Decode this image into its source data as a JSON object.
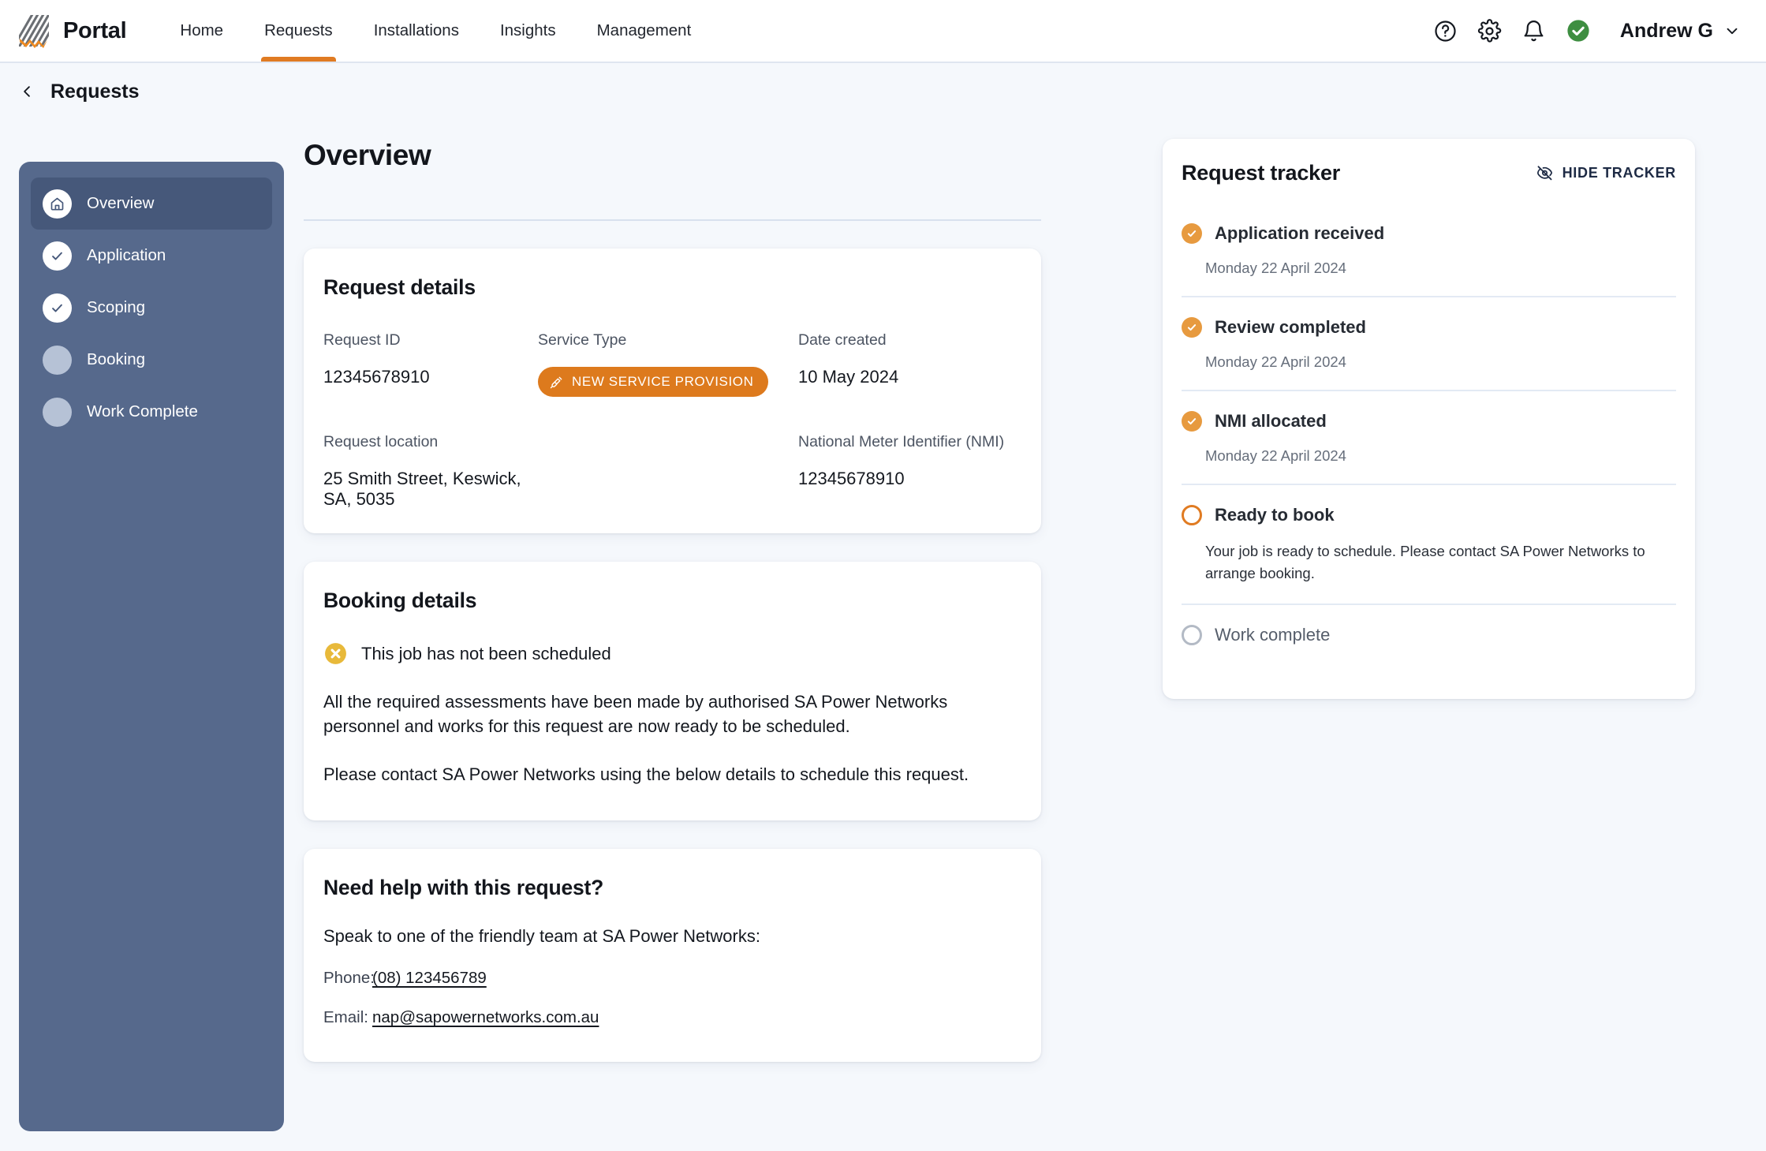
{
  "header": {
    "brand": "Portal",
    "logo_icon": "hatched-square-lightning-logo",
    "nav": [
      {
        "label": "Home",
        "active": false
      },
      {
        "label": "Requests",
        "active": true
      },
      {
        "label": "Installations",
        "active": false
      },
      {
        "label": "Insights",
        "active": false
      },
      {
        "label": "Management",
        "active": false
      }
    ],
    "icons": [
      "help-circle-icon",
      "gear-icon",
      "bell-icon",
      "check-circle-icon"
    ],
    "user": "Andrew G",
    "user_chevron": "chevron-down-icon",
    "accent_color": "#e07b22"
  },
  "breadcrumb": {
    "back_icon": "chevron-left-icon",
    "title": "Requests"
  },
  "sidebar": {
    "background_color": "#56698c",
    "items": [
      {
        "label": "Overview",
        "icon": "home-icon",
        "state": "active"
      },
      {
        "label": "Application",
        "icon": "check-icon",
        "state": "complete"
      },
      {
        "label": "Scoping",
        "icon": "check-icon",
        "state": "complete"
      },
      {
        "label": "Booking",
        "icon": "",
        "state": "pending"
      },
      {
        "label": "Work Complete",
        "icon": "",
        "state": "pending"
      }
    ]
  },
  "main": {
    "page_title": "Overview",
    "request_details": {
      "heading": "Request details",
      "request_id_label": "Request ID",
      "request_id_value": "12345678910",
      "service_type_label": "Service Type",
      "service_type_badge": "NEW SERVICE PROVISION",
      "service_type_badge_icon": "plug-connector-icon",
      "date_created_label": "Date created",
      "date_created_value": "10 May 2024",
      "request_location_label": "Request location",
      "request_location_value": "25 Smith Street, Keswick, SA, 5035",
      "nmi_label": "National Meter Identifier (NMI)",
      "nmi_value": "12345678910"
    },
    "booking_details": {
      "heading": "Booking details",
      "status_icon": "x-circle-icon",
      "status_color": "#e8b93a",
      "status_text": "This job has not been scheduled",
      "paragraph_1": "All the required assessments have been made by authorised SA Power Networks personnel and works for this request are now ready to be scheduled.",
      "paragraph_2": "Please contact SA Power Networks using the below details to schedule this request."
    },
    "help": {
      "heading": "Need help with this request?",
      "intro": "Speak to one of the friendly team at SA Power Networks:",
      "phone_label": "Phone:",
      "phone_value": "(08) 123456789",
      "email_label": "Email:",
      "email_value": "nap@sapowernetworks.com.au"
    }
  },
  "tracker": {
    "title": "Request tracker",
    "hide_label": "HIDE TRACKER",
    "hide_icon": "eye-off-icon",
    "steps": [
      {
        "label": "Application received",
        "date": "Monday 22 April 2024",
        "note": "",
        "state": "done"
      },
      {
        "label": "Review completed",
        "date": "Monday 22 April 2024",
        "note": "",
        "state": "done"
      },
      {
        "label": "NMI allocated",
        "date": "Monday 22 April 2024",
        "note": "",
        "state": "done"
      },
      {
        "label": "Ready to book",
        "date": "",
        "note": "Your job is ready to schedule. Please contact SA Power Networks to arrange booking.",
        "state": "current"
      },
      {
        "label": "Work complete",
        "date": "",
        "note": "",
        "state": "pending"
      }
    ]
  }
}
